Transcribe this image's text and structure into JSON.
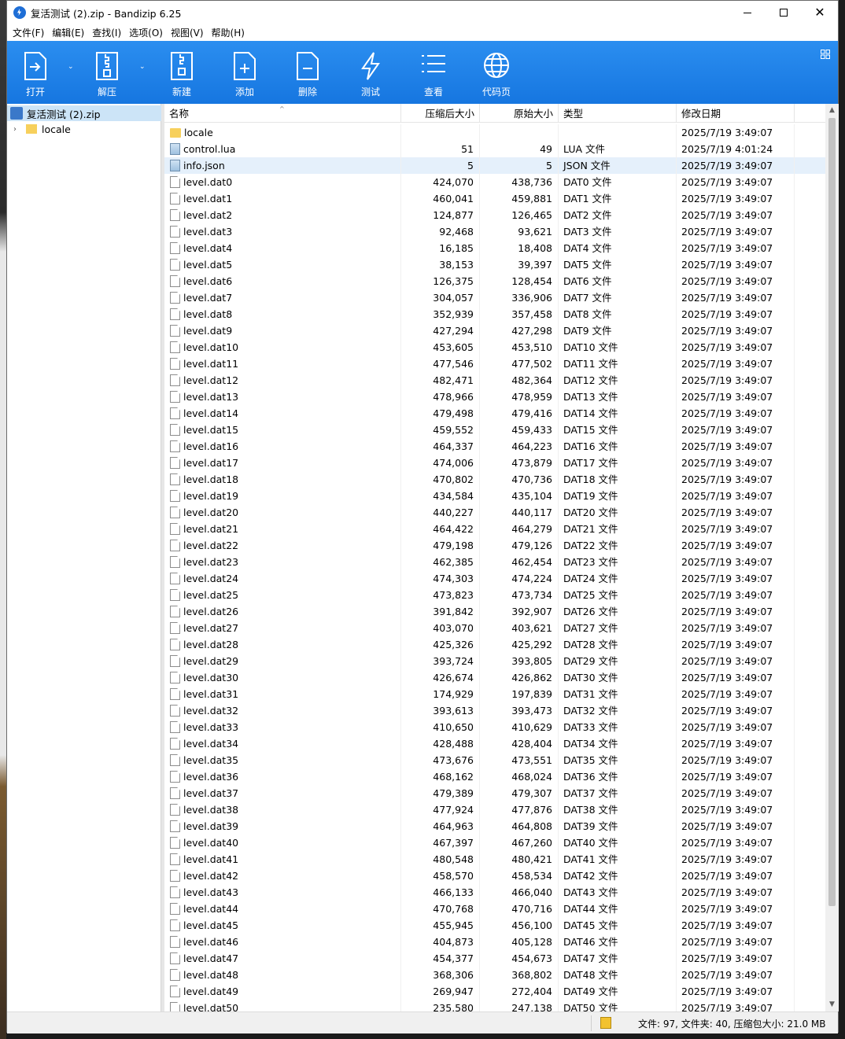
{
  "window": {
    "title": "复活测试 (2).zip - Bandizip 6.25"
  },
  "menu": [
    "文件(F)",
    "编辑(E)",
    "查找(I)",
    "选项(O)",
    "视图(V)",
    "帮助(H)"
  ],
  "toolbar": {
    "open": "打开",
    "extract": "解压",
    "new": "新建",
    "add": "添加",
    "delete": "删除",
    "test": "测试",
    "view": "查看",
    "codepage": "代码页"
  },
  "tree": {
    "root": "复活测试 (2).zip",
    "child": "locale"
  },
  "columns": {
    "name": "名称",
    "packed": "压缩后大小",
    "original": "原始大小",
    "type": "类型",
    "modified": "修改日期"
  },
  "rows": [
    {
      "icon": "folder",
      "name": "locale",
      "packed": "",
      "original": "",
      "type": "",
      "modified": "2025/7/19 3:49:07"
    },
    {
      "icon": "doc",
      "name": "control.lua",
      "packed": "51",
      "original": "49",
      "type": "LUA 文件",
      "modified": "2025/7/19 4:01:24"
    },
    {
      "icon": "doc",
      "name": "info.json",
      "packed": "5",
      "original": "5",
      "type": "JSON 文件",
      "modified": "2025/7/19 3:49:07",
      "selected": true
    },
    {
      "icon": "file",
      "name": "level.dat0",
      "packed": "424,070",
      "original": "438,736",
      "type": "DAT0 文件",
      "modified": "2025/7/19 3:49:07"
    },
    {
      "icon": "file",
      "name": "level.dat1",
      "packed": "460,041",
      "original": "459,881",
      "type": "DAT1 文件",
      "modified": "2025/7/19 3:49:07"
    },
    {
      "icon": "file",
      "name": "level.dat2",
      "packed": "124,877",
      "original": "126,465",
      "type": "DAT2 文件",
      "modified": "2025/7/19 3:49:07"
    },
    {
      "icon": "file",
      "name": "level.dat3",
      "packed": "92,468",
      "original": "93,621",
      "type": "DAT3 文件",
      "modified": "2025/7/19 3:49:07"
    },
    {
      "icon": "file",
      "name": "level.dat4",
      "packed": "16,185",
      "original": "18,408",
      "type": "DAT4 文件",
      "modified": "2025/7/19 3:49:07"
    },
    {
      "icon": "file",
      "name": "level.dat5",
      "packed": "38,153",
      "original": "39,397",
      "type": "DAT5 文件",
      "modified": "2025/7/19 3:49:07"
    },
    {
      "icon": "file",
      "name": "level.dat6",
      "packed": "126,375",
      "original": "128,454",
      "type": "DAT6 文件",
      "modified": "2025/7/19 3:49:07"
    },
    {
      "icon": "file",
      "name": "level.dat7",
      "packed": "304,057",
      "original": "336,906",
      "type": "DAT7 文件",
      "modified": "2025/7/19 3:49:07"
    },
    {
      "icon": "file",
      "name": "level.dat8",
      "packed": "352,939",
      "original": "357,458",
      "type": "DAT8 文件",
      "modified": "2025/7/19 3:49:07"
    },
    {
      "icon": "file",
      "name": "level.dat9",
      "packed": "427,294",
      "original": "427,298",
      "type": "DAT9 文件",
      "modified": "2025/7/19 3:49:07"
    },
    {
      "icon": "file",
      "name": "level.dat10",
      "packed": "453,605",
      "original": "453,510",
      "type": "DAT10 文件",
      "modified": "2025/7/19 3:49:07"
    },
    {
      "icon": "file",
      "name": "level.dat11",
      "packed": "477,546",
      "original": "477,502",
      "type": "DAT11 文件",
      "modified": "2025/7/19 3:49:07"
    },
    {
      "icon": "file",
      "name": "level.dat12",
      "packed": "482,471",
      "original": "482,364",
      "type": "DAT12 文件",
      "modified": "2025/7/19 3:49:07"
    },
    {
      "icon": "file",
      "name": "level.dat13",
      "packed": "478,966",
      "original": "478,959",
      "type": "DAT13 文件",
      "modified": "2025/7/19 3:49:07"
    },
    {
      "icon": "file",
      "name": "level.dat14",
      "packed": "479,498",
      "original": "479,416",
      "type": "DAT14 文件",
      "modified": "2025/7/19 3:49:07"
    },
    {
      "icon": "file",
      "name": "level.dat15",
      "packed": "459,552",
      "original": "459,433",
      "type": "DAT15 文件",
      "modified": "2025/7/19 3:49:07"
    },
    {
      "icon": "file",
      "name": "level.dat16",
      "packed": "464,337",
      "original": "464,223",
      "type": "DAT16 文件",
      "modified": "2025/7/19 3:49:07"
    },
    {
      "icon": "file",
      "name": "level.dat17",
      "packed": "474,006",
      "original": "473,879",
      "type": "DAT17 文件",
      "modified": "2025/7/19 3:49:07"
    },
    {
      "icon": "file",
      "name": "level.dat18",
      "packed": "470,802",
      "original": "470,736",
      "type": "DAT18 文件",
      "modified": "2025/7/19 3:49:07"
    },
    {
      "icon": "file",
      "name": "level.dat19",
      "packed": "434,584",
      "original": "435,104",
      "type": "DAT19 文件",
      "modified": "2025/7/19 3:49:07"
    },
    {
      "icon": "file",
      "name": "level.dat20",
      "packed": "440,227",
      "original": "440,117",
      "type": "DAT20 文件",
      "modified": "2025/7/19 3:49:07"
    },
    {
      "icon": "file",
      "name": "level.dat21",
      "packed": "464,422",
      "original": "464,279",
      "type": "DAT21 文件",
      "modified": "2025/7/19 3:49:07"
    },
    {
      "icon": "file",
      "name": "level.dat22",
      "packed": "479,198",
      "original": "479,126",
      "type": "DAT22 文件",
      "modified": "2025/7/19 3:49:07"
    },
    {
      "icon": "file",
      "name": "level.dat23",
      "packed": "462,385",
      "original": "462,454",
      "type": "DAT23 文件",
      "modified": "2025/7/19 3:49:07"
    },
    {
      "icon": "file",
      "name": "level.dat24",
      "packed": "474,303",
      "original": "474,224",
      "type": "DAT24 文件",
      "modified": "2025/7/19 3:49:07"
    },
    {
      "icon": "file",
      "name": "level.dat25",
      "packed": "473,823",
      "original": "473,734",
      "type": "DAT25 文件",
      "modified": "2025/7/19 3:49:07"
    },
    {
      "icon": "file",
      "name": "level.dat26",
      "packed": "391,842",
      "original": "392,907",
      "type": "DAT26 文件",
      "modified": "2025/7/19 3:49:07"
    },
    {
      "icon": "file",
      "name": "level.dat27",
      "packed": "403,070",
      "original": "403,621",
      "type": "DAT27 文件",
      "modified": "2025/7/19 3:49:07"
    },
    {
      "icon": "file",
      "name": "level.dat28",
      "packed": "425,326",
      "original": "425,292",
      "type": "DAT28 文件",
      "modified": "2025/7/19 3:49:07"
    },
    {
      "icon": "file",
      "name": "level.dat29",
      "packed": "393,724",
      "original": "393,805",
      "type": "DAT29 文件",
      "modified": "2025/7/19 3:49:07"
    },
    {
      "icon": "file",
      "name": "level.dat30",
      "packed": "426,674",
      "original": "426,862",
      "type": "DAT30 文件",
      "modified": "2025/7/19 3:49:07"
    },
    {
      "icon": "file",
      "name": "level.dat31",
      "packed": "174,929",
      "original": "197,839",
      "type": "DAT31 文件",
      "modified": "2025/7/19 3:49:07"
    },
    {
      "icon": "file",
      "name": "level.dat32",
      "packed": "393,613",
      "original": "393,473",
      "type": "DAT32 文件",
      "modified": "2025/7/19 3:49:07"
    },
    {
      "icon": "file",
      "name": "level.dat33",
      "packed": "410,650",
      "original": "410,629",
      "type": "DAT33 文件",
      "modified": "2025/7/19 3:49:07"
    },
    {
      "icon": "file",
      "name": "level.dat34",
      "packed": "428,488",
      "original": "428,404",
      "type": "DAT34 文件",
      "modified": "2025/7/19 3:49:07"
    },
    {
      "icon": "file",
      "name": "level.dat35",
      "packed": "473,676",
      "original": "473,551",
      "type": "DAT35 文件",
      "modified": "2025/7/19 3:49:07"
    },
    {
      "icon": "file",
      "name": "level.dat36",
      "packed": "468,162",
      "original": "468,024",
      "type": "DAT36 文件",
      "modified": "2025/7/19 3:49:07"
    },
    {
      "icon": "file",
      "name": "level.dat37",
      "packed": "479,389",
      "original": "479,307",
      "type": "DAT37 文件",
      "modified": "2025/7/19 3:49:07"
    },
    {
      "icon": "file",
      "name": "level.dat38",
      "packed": "477,924",
      "original": "477,876",
      "type": "DAT38 文件",
      "modified": "2025/7/19 3:49:07"
    },
    {
      "icon": "file",
      "name": "level.dat39",
      "packed": "464,963",
      "original": "464,808",
      "type": "DAT39 文件",
      "modified": "2025/7/19 3:49:07"
    },
    {
      "icon": "file",
      "name": "level.dat40",
      "packed": "467,397",
      "original": "467,260",
      "type": "DAT40 文件",
      "modified": "2025/7/19 3:49:07"
    },
    {
      "icon": "file",
      "name": "level.dat41",
      "packed": "480,548",
      "original": "480,421",
      "type": "DAT41 文件",
      "modified": "2025/7/19 3:49:07"
    },
    {
      "icon": "file",
      "name": "level.dat42",
      "packed": "458,570",
      "original": "458,534",
      "type": "DAT42 文件",
      "modified": "2025/7/19 3:49:07"
    },
    {
      "icon": "file",
      "name": "level.dat43",
      "packed": "466,133",
      "original": "466,040",
      "type": "DAT43 文件",
      "modified": "2025/7/19 3:49:07"
    },
    {
      "icon": "file",
      "name": "level.dat44",
      "packed": "470,768",
      "original": "470,716",
      "type": "DAT44 文件",
      "modified": "2025/7/19 3:49:07"
    },
    {
      "icon": "file",
      "name": "level.dat45",
      "packed": "455,945",
      "original": "456,100",
      "type": "DAT45 文件",
      "modified": "2025/7/19 3:49:07"
    },
    {
      "icon": "file",
      "name": "level.dat46",
      "packed": "404,873",
      "original": "405,128",
      "type": "DAT46 文件",
      "modified": "2025/7/19 3:49:07"
    },
    {
      "icon": "file",
      "name": "level.dat47",
      "packed": "454,377",
      "original": "454,673",
      "type": "DAT47 文件",
      "modified": "2025/7/19 3:49:07"
    },
    {
      "icon": "file",
      "name": "level.dat48",
      "packed": "368,306",
      "original": "368,802",
      "type": "DAT48 文件",
      "modified": "2025/7/19 3:49:07"
    },
    {
      "icon": "file",
      "name": "level.dat49",
      "packed": "269,947",
      "original": "272,404",
      "type": "DAT49 文件",
      "modified": "2025/7/19 3:49:07"
    },
    {
      "icon": "file",
      "name": "level.dat50",
      "packed": "235,580",
      "original": "247,138",
      "type": "DAT50 文件",
      "modified": "2025/7/19 3:49:07"
    }
  ],
  "status": {
    "summary": "文件: 97, 文件夹: 40, 压缩包大小: 21.0 MB"
  },
  "colors": {
    "toolbar": "#1676e0",
    "selection": "#e5f0fb",
    "tree_selection": "#cce4f7",
    "folder": "#f7d05c"
  }
}
